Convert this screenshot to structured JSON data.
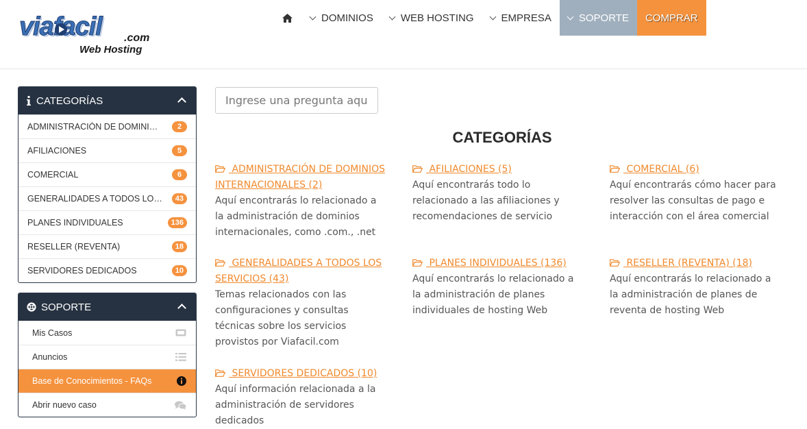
{
  "header": {
    "logo": {
      "main": "viafacil",
      "domain": ".com",
      "tagline": "Web Hosting"
    },
    "nav": [
      {
        "label": "DOMINIOS"
      },
      {
        "label": "WEB HOSTING"
      },
      {
        "label": "EMPRESA"
      },
      {
        "label": "SOPORTE"
      },
      {
        "label": "COMPRAR"
      }
    ]
  },
  "sidebar": {
    "categories": {
      "title": "CATEGORÍAS",
      "items": [
        {
          "label": "ADMINISTRACIÓN DE DOMINIOS INTERNACIONALES",
          "count": "2"
        },
        {
          "label": "AFILIACIONES",
          "count": "5"
        },
        {
          "label": "COMERCIAL",
          "count": "6"
        },
        {
          "label": "GENERALIDADES A TODOS LOS SERVICIOS",
          "count": "43"
        },
        {
          "label": "PLANES INDIVIDUALES",
          "count": "136"
        },
        {
          "label": "RESELLER (REVENTA)",
          "count": "18"
        },
        {
          "label": "SERVIDORES DEDICADOS",
          "count": "10"
        }
      ]
    },
    "support": {
      "title": "SOPORTE",
      "items": [
        {
          "label": "Mis Casos",
          "icon": "ticket-icon"
        },
        {
          "label": "Anuncios",
          "icon": "list-icon"
        },
        {
          "label": "Base de Conocimientos - FAQs",
          "icon": "info-icon",
          "active": true
        },
        {
          "label": "Abrir nuevo caso",
          "icon": "comments-icon"
        }
      ]
    }
  },
  "main": {
    "search": {
      "placeholder": "Ingrese una pregunta aquí para buscar respuestas",
      "value": ""
    },
    "title": "CATEGORÍAS",
    "categories": [
      {
        "title": " ADMINISTRACIÓN DE DOMINIOS INTERNACIONALES (2)",
        "desc": "Aquí encontrarás lo relacionado a la administración de dominios internacionales, como .com., .net"
      },
      {
        "title": " AFILIACIONES (5)",
        "desc": "Aquí encontrarás todo lo relacionado a las afiliaciones y recomendaciones de servicio"
      },
      {
        "title": " COMERCIAL (6)",
        "desc": "Aquí encontrarás cómo hacer para resolver las consultas de pago e interacción con el área comercial"
      },
      {
        "title": " GENERALIDADES A TODOS LOS SERVICIOS (43)",
        "desc": "Temas relacionados con las configuraciones y consultas técnicas sobre los servicios provistos por Viafacil.com"
      },
      {
        "title": " PLANES INDIVIDUALES (136)",
        "desc": "Aquí encontrarás lo relacionado a la administración de planes individuales de hosting Web"
      },
      {
        "title": " RESELLER (REVENTA) (18)",
        "desc": "Aquí encontrarás lo relacionado a la administración de planes de reventa de hosting Web"
      },
      {
        "title": " SERVIDORES DEDICADOS (10)",
        "desc": "Aquí información relacionada a la administración de servidores dedicados"
      }
    ]
  },
  "colors": {
    "accent": "#f5923e",
    "panel_header": "#263241",
    "link": "#f0892c",
    "nav_active": "#9fafbd"
  }
}
